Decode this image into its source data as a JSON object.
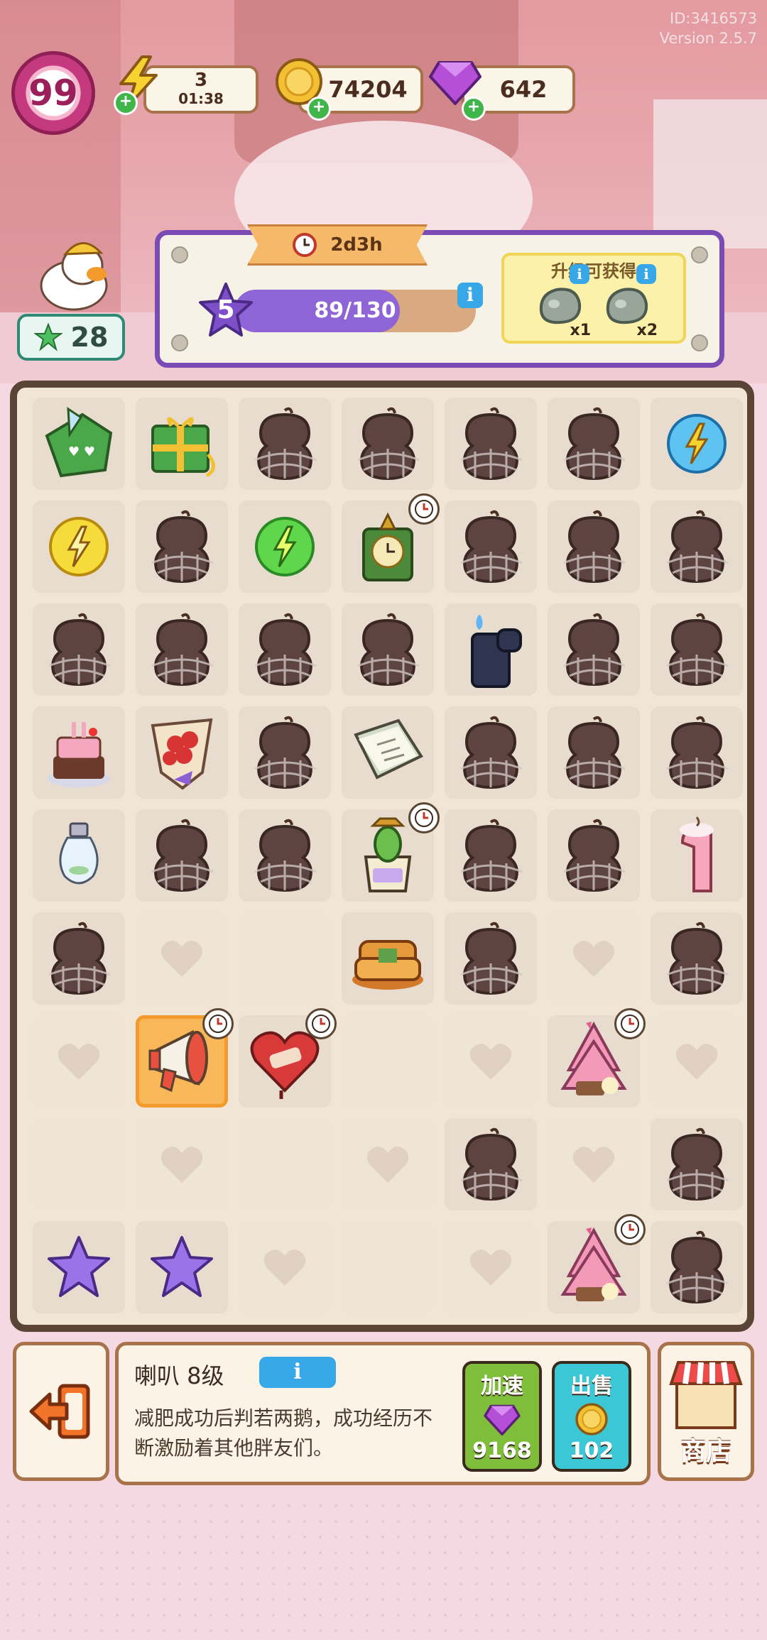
{
  "app": {
    "id_text": "ID:3416573",
    "version_text": "Version 2.5.7"
  },
  "hud": {
    "player_level": "99",
    "energy": {
      "value": "3",
      "timer": "01:38"
    },
    "coins": "74204",
    "gems": "642",
    "leaves": "28"
  },
  "event": {
    "timer": "2d3h",
    "level": "5",
    "progress_text": "89/130",
    "progress_fraction": 0.685,
    "reward_title": "升级可获得",
    "rewards": [
      {
        "name": "stone-icon",
        "qty": "x1"
      },
      {
        "name": "stone-icon",
        "qty": "x2"
      }
    ]
  },
  "board": {
    "rows": 9,
    "cols": 7,
    "cells": [
      [
        "green-box",
        "green-gift",
        "web-bag",
        "web-bag",
        "web-bag",
        "web-bag",
        "blue-energy"
      ],
      [
        "yellow-energy",
        "web-bag",
        "green-energy",
        "green-clock",
        "web-bag",
        "web-bag",
        "web-bag"
      ],
      [
        "web-bag",
        "web-bag",
        "web-bag",
        "web-bag",
        "lighter",
        "web-bag",
        "web-bag"
      ],
      [
        "cake",
        "bouquet",
        "web-bag",
        "notebook",
        "web-bag",
        "web-bag",
        "web-bag"
      ],
      [
        "bulb",
        "web-bag",
        "web-bag",
        "cactus-pot",
        "web-bag",
        "web-bag",
        "candle"
      ],
      [
        "web-bag",
        "heart",
        "empty",
        "sofa",
        "web-bag",
        "heart",
        "web-bag"
      ],
      [
        "heart",
        "megaphone",
        "broken-heart",
        "empty",
        "heart",
        "pink-tree",
        "heart"
      ],
      [
        "empty",
        "heart",
        "empty",
        "heart",
        "web-bag",
        "heart",
        "web-bag"
      ],
      [
        "purple-star",
        "purple-star",
        "heart",
        "empty",
        "heart",
        "pink-tree",
        "web-bag"
      ]
    ],
    "timed_items": [
      "green-clock",
      "cactus-pot",
      "megaphone",
      "broken-heart",
      "pink-tree"
    ],
    "selected_item": "megaphone"
  },
  "bottom": {
    "item_name": "喇叭 8级",
    "item_desc": "减肥成功后判若两鹅，成功经历不断激励着其他胖友们。",
    "speed_label": "加速",
    "speed_value": "9168",
    "sell_label": "出售",
    "sell_value": "102",
    "shop_label": "商店"
  }
}
